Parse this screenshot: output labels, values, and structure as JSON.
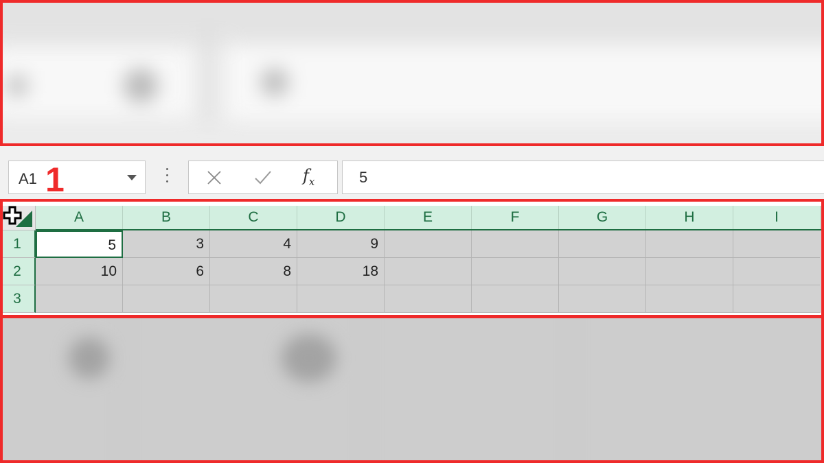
{
  "name_box": {
    "value": "A1"
  },
  "step_marker": "1",
  "formula_bar": {
    "fx_label": "f",
    "fx_sub": "x",
    "value": "5"
  },
  "columns": [
    "A",
    "B",
    "C",
    "D",
    "E",
    "F",
    "G",
    "H",
    "I"
  ],
  "rows": [
    {
      "label": "1",
      "cells": [
        "5",
        "3",
        "4",
        "9",
        "",
        "",
        "",
        "",
        ""
      ]
    },
    {
      "label": "2",
      "cells": [
        "10",
        "6",
        "8",
        "18",
        "",
        "",
        "",
        "",
        ""
      ]
    },
    {
      "label": "3",
      "cells": [
        "",
        "",
        "",
        "",
        "",
        "",
        "",
        "",
        ""
      ]
    }
  ],
  "active_cell": "A1",
  "colors": {
    "highlight": "#ef2a2a",
    "accent": "#1e6e42",
    "header_bg": "#d2efe0"
  }
}
